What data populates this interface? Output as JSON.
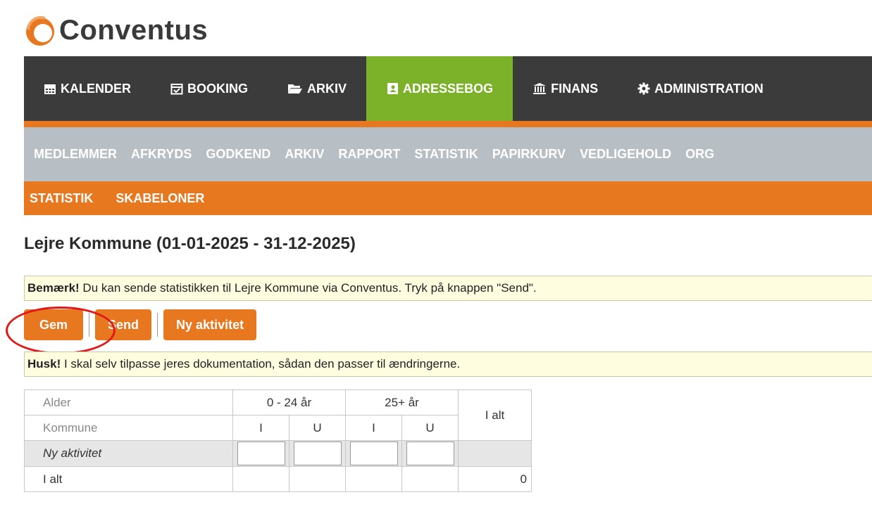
{
  "brand": {
    "name": "Conventus",
    "logo_icon": "conventus-logo-icon",
    "colors": {
      "orange": "#e8781f",
      "green": "#7bb22a",
      "dark": "#3b3b3b",
      "grey": "#b8bfc4"
    }
  },
  "topnav": {
    "items": [
      {
        "label": "KALENDER",
        "icon": "calendar-icon"
      },
      {
        "label": "BOOKING",
        "icon": "calendar-check-icon"
      },
      {
        "label": "ARKIV",
        "icon": "folder-open-icon"
      },
      {
        "label": "ADRESSEBOG",
        "icon": "address-book-icon",
        "active": true
      },
      {
        "label": "FINANS",
        "icon": "bank-icon"
      },
      {
        "label": "ADMINISTRATION",
        "icon": "gear-icon"
      }
    ]
  },
  "subnav": {
    "items": [
      "MEDLEMMER",
      "AFKRYDS",
      "GODKEND",
      "ARKIV",
      "RAPPORT",
      "STATISTIK",
      "PAPIRKURV",
      "VEDLIGEHOLD",
      "ORG"
    ]
  },
  "tertnav": {
    "items": [
      "STATISTIK",
      "SKABELONER"
    ]
  },
  "page": {
    "title": "Lejre Kommune (01-01-2025 - 31-12-2025)"
  },
  "notice1": {
    "strong": "Bemærk!",
    "text": " Du kan sende statistikken til Lejre Kommune via Conventus. Tryk på knappen \"Send\"."
  },
  "buttons": {
    "save": "Gem",
    "send": "Send",
    "new_activity": "Ny aktivitet"
  },
  "notice2": {
    "strong": "Husk!",
    "text": " I skal selv tilpasse jeres dokumentation, sådan den passer til ændringerne."
  },
  "table": {
    "row1_label": "Alder",
    "row2_label": "Kommune",
    "age_group_1": "0 - 24 år",
    "age_group_2": "25+ år",
    "total_header": "I alt",
    "sub_I": "I",
    "sub_U": "U",
    "activity_row_label": "Ny aktivitet",
    "total_row_label": "I alt",
    "total_value": "0"
  }
}
